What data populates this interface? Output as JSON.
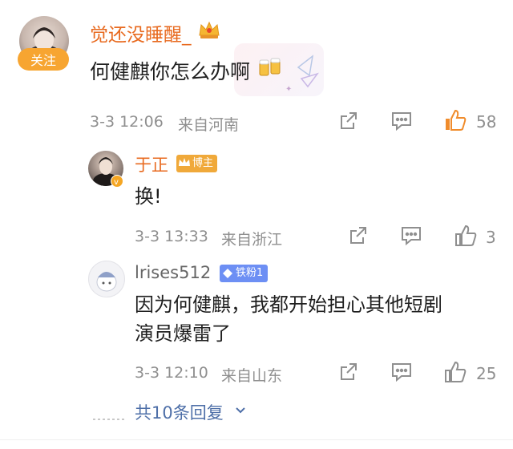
{
  "comment": {
    "author": "觉还没睡醒_",
    "follow_label": "关注",
    "text": "何健麒你怎么办啊",
    "time": "3-3 12:06",
    "location": "来自河南",
    "likes": "58",
    "icons": [
      "avatar",
      "crown-icon",
      "beer-emoji-icon",
      "share-icon",
      "comment-icon",
      "like-icon"
    ]
  },
  "replies": [
    {
      "author": "于正",
      "badge": "博主",
      "text": "换!",
      "time": "3-3 13:33",
      "location": "来自浙江",
      "likes": "3"
    },
    {
      "author": "lrises512",
      "badge": "铁粉1",
      "text_line1": "因为何健麒，我都开始担心其他短剧",
      "text_line2": "演员爆雷了",
      "time": "3-3 12:10",
      "location": "来自山东",
      "likes": "25"
    }
  ],
  "more_replies": "共10条回复",
  "colors": {
    "author_orange": "#e86a1f",
    "like_orange": "#f08c2c",
    "follow_bg": "#f7a531",
    "link_blue": "#4e6fa8",
    "meta_gray": "#8f8f8f"
  }
}
